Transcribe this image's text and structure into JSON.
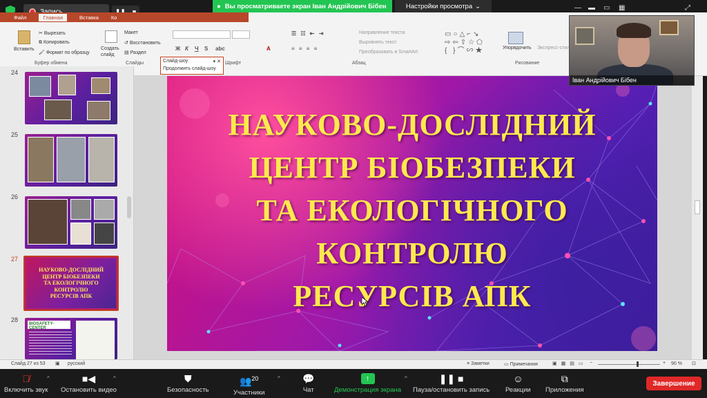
{
  "zoom_top": {
    "recording_label": "Запись...",
    "share_banner": "Вы просматриваете экран Іван Андрійович Бібен",
    "view_options": "Настройки просмотра"
  },
  "ribbon": {
    "tabs": [
      "Файл",
      "Главная",
      "Вставка",
      "Ко"
    ],
    "active_tab": "Главная",
    "clipboard": {
      "paste": "Вставить",
      "cut": "Вырезать",
      "copy": "Копировать",
      "format_painter": "Формат по образцу",
      "group": "Буфер обмена"
    },
    "slides": {
      "new_slide": "Создать слайд",
      "layout": "Макет",
      "reset": "Восстановить",
      "section": "Раздел",
      "group": "Слайды"
    },
    "font": {
      "group": "Шрифт"
    },
    "paragraph": {
      "text_direction": "Направление текста",
      "align_text": "Выровнять текст",
      "convert_smartart": "Преобразовать в SmartArt",
      "group": "Абзац"
    },
    "drawing": {
      "arrange": "Упорядочить",
      "quick_styles": "Экспресс-стили",
      "group": "Рисование"
    }
  },
  "slideshow_popup": {
    "title": "Слайд-шоу",
    "resume": "Продолжить слайд-шоу"
  },
  "thumbnails": [
    {
      "num": "24"
    },
    {
      "num": "25"
    },
    {
      "num": "26"
    },
    {
      "num": "27",
      "lines": [
        "НАУКОВО-ДОСЛІДНИЙ",
        "ЦЕНТР БІОБЕЗПЕКИ",
        "ТА ЕКОЛОГІЧНОГО",
        "КОНТРОЛЮ",
        "РЕСУРСІВ АПК"
      ]
    },
    {
      "num": "28",
      "logo": "BIOSAFETY-CENTER"
    }
  ],
  "slide": {
    "lines": [
      "НАУКОВО-ДОСЛІДНИЙ",
      "ЦЕНТР БІОБЕЗПЕКИ",
      "ТА ЕКОЛОГІЧНОГО",
      "КОНТРОЛЮ",
      "РЕСУРСІВ АПК"
    ]
  },
  "presenter": {
    "name": "Іван Андрійович Бібен"
  },
  "status": {
    "slide_info": "Слайд 27 из 53",
    "language": "русский",
    "notes": "Заметки",
    "comments": "Примечания",
    "zoom": "90 %"
  },
  "zoom_bottom": {
    "mute": "Включить звук",
    "stop_video": "Остановить видео",
    "security": "Безопасность",
    "participants": "Участники",
    "participants_count": "20",
    "chat": "Чат",
    "share_screen": "Демонстрация экрана",
    "pause_record": "Пауза/остановить запись",
    "reactions": "Реакции",
    "apps": "Приложения",
    "end": "Завершение"
  }
}
